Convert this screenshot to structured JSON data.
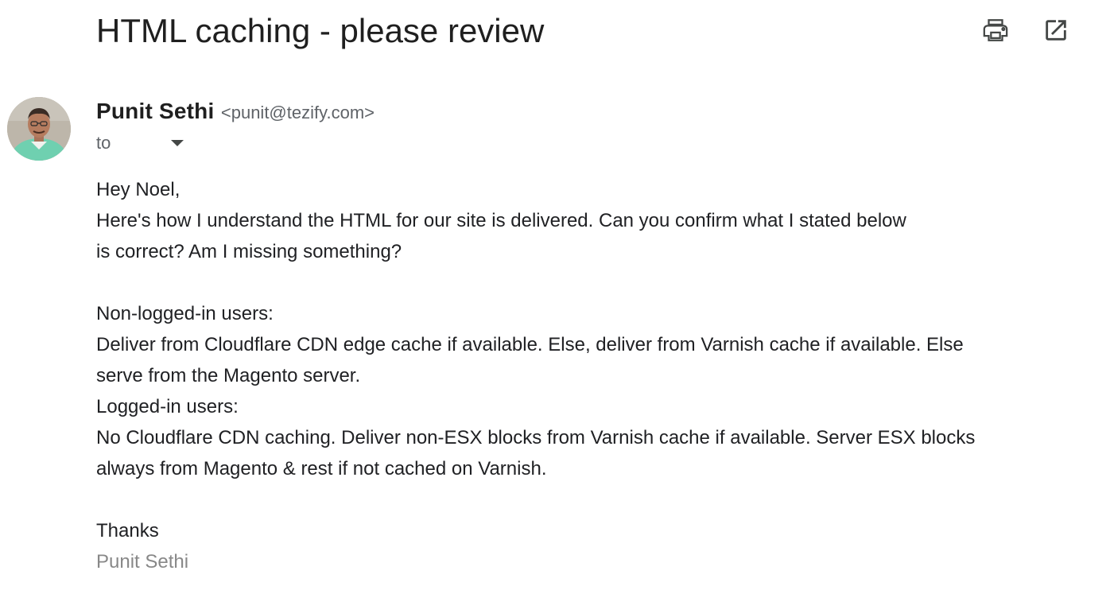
{
  "email": {
    "subject": "HTML caching - please review",
    "sender_name": "Punit Sethi",
    "sender_email": "<punit@tezify.com>",
    "to_label": "to",
    "body": {
      "greeting": "Hey Noel,",
      "intro_line1": "Here's how I understand the HTML for our site is delivered. Can you confirm what I stated below",
      "intro_line2": "is correct? Am I missing something?",
      "nonlogged_heading": "Non-logged-in users:",
      "nonlogged_line1": "Deliver from Cloudflare CDN edge cache if available. Else, deliver from Varnish cache if available. Else",
      "nonlogged_line2": "serve from the Magento server.",
      "logged_heading": "Logged-in users:",
      "logged_line1": "No Cloudflare CDN caching. Deliver non-ESX blocks from Varnish cache if available. Server ESX blocks",
      "logged_line2": "always from Magento & rest if not cached on Varnish.",
      "closing": "Thanks",
      "signature": "Punit Sethi"
    }
  },
  "icons": {
    "print": "print-icon",
    "open_new_window": "open-in-new-icon",
    "recipients_dropdown": "arrow-drop-down-icon"
  },
  "colors": {
    "subject_text": "#1f1f1f",
    "secondary_text": "#5f6368",
    "body_text": "#202124",
    "signature_text": "#888888"
  }
}
